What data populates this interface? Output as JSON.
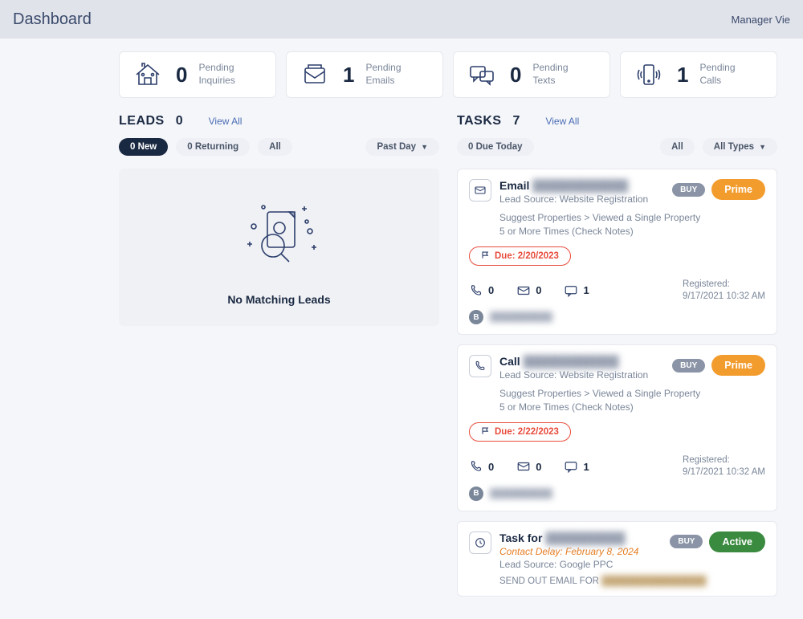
{
  "header": {
    "title": "Dashboard",
    "right": "Manager Vie"
  },
  "stats": [
    {
      "count": "0",
      "label1": "Pending",
      "label2": "Inquiries"
    },
    {
      "count": "1",
      "label1": "Pending",
      "label2": "Emails"
    },
    {
      "count": "0",
      "label1": "Pending",
      "label2": "Texts"
    },
    {
      "count": "1",
      "label1": "Pending",
      "label2": "Calls"
    }
  ],
  "leads": {
    "title": "LEADS",
    "count": "0",
    "viewAll": "View All",
    "filters": {
      "new": "0 New",
      "returning": "0 Returning",
      "all": "All",
      "range": "Past Day"
    },
    "empty": "No Matching Leads"
  },
  "tasks": {
    "title": "TASKS",
    "count": "7",
    "viewAll": "View All",
    "filters": {
      "due": "0 Due Today",
      "all": "All",
      "types": "All Types"
    },
    "items": [
      {
        "type": "Email",
        "name": "████████████",
        "source": "Lead Source: Website Registration",
        "desc": "Suggest Properties > Viewed a Single Property 5 or More Times (Check Notes)",
        "due": "Due: 2/20/2023",
        "buy": "BUY",
        "status": "Prime",
        "statusClass": "badge-prime",
        "calls": "0",
        "emails": "0",
        "texts": "1",
        "regLabel": "Registered:",
        "regTime": "9/17/2021 10:32 AM",
        "avatarLetter": "B",
        "agent": "██████████"
      },
      {
        "type": "Call",
        "name": "████████████",
        "source": "Lead Source: Website Registration",
        "desc": "Suggest Properties > Viewed a Single Property 5 or More Times (Check Notes)",
        "due": "Due: 2/22/2023",
        "buy": "BUY",
        "status": "Prime",
        "statusClass": "badge-prime",
        "calls": "0",
        "emails": "0",
        "texts": "1",
        "regLabel": "Registered:",
        "regTime": "9/17/2021 10:32 AM",
        "avatarLetter": "B",
        "agent": "██████████"
      },
      {
        "type": "Task for",
        "name": "██████████",
        "contactDelay": "Contact Delay: February 8, 2024",
        "source": "Lead Source: Google PPC",
        "sendLabel": "SEND OUT EMAIL FOR ",
        "sendTarget": "████████████████",
        "buy": "BUY",
        "status": "Active",
        "statusClass": "badge-active",
        "taskIcon": "clock"
      }
    ]
  }
}
